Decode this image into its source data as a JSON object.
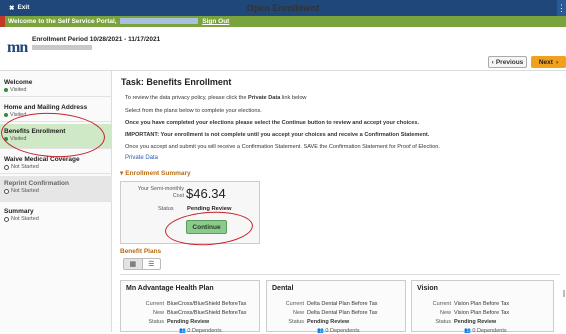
{
  "titlebar": {
    "exit_label": "Exit",
    "title": "Open Enrollment",
    "menu_glyph": "⋮"
  },
  "welcome_bar": {
    "text": "Welcome to the Self Service Portal,",
    "sign_out": "Sign Out"
  },
  "header": {
    "logo_text": "mn",
    "enrollment_period": "Enrollment Period  10/28/2021 - 11/17/2021",
    "prev_label": "Previous",
    "next_label": "Next"
  },
  "sidebar": {
    "items": [
      {
        "label": "Welcome",
        "status": "Visited"
      },
      {
        "label": "Home and Mailing Address",
        "status": "Visited"
      },
      {
        "label": "Benefits Enrollment",
        "status": "Visited"
      },
      {
        "label": "Waive Medical Coverage",
        "status": "Not Started"
      },
      {
        "label": "Reprint Confirmation",
        "status": "Not Started"
      },
      {
        "label": "Summary",
        "status": "Not Started"
      }
    ]
  },
  "main": {
    "title": "Task: Benefits Enrollment",
    "para1_a": "To review the data privacy policy, please click the ",
    "para1_b": "Private Data",
    "para1_c": " link below",
    "para2": "Select from the plans below to complete your elections.",
    "para3": "Once you have completed your elections please select the Continue button to review and accept your choices.",
    "para4": "IMPORTANT: Your enrollment is not complete until you accept your choices and receive a Confirmation Statement.",
    "para5": "Once you accept and submit you will receive a Confirmation Statement. SAVE the Confirmation Statement for Proof of Election.",
    "private_data_link": "Private Data",
    "summary_heading": "Enrollment Summary",
    "cost_label_1": "Your Semi-monthly",
    "cost_label_2": "Cost",
    "cost_value": "$46.34",
    "status_label": "Status",
    "status_value": "Pending Review",
    "continue_label": "Continue",
    "plans_heading": "Benefit Plans"
  },
  "plans": [
    {
      "name": "Mn Advantage Health Plan",
      "current_label": "Current",
      "current": "BlueCross/BlueShield BeforeTax",
      "new_label": "New",
      "new": "BlueCross/BlueShield BeforeTax",
      "status_label": "Status",
      "status": "Pending Review",
      "dependents": "0 Dependents"
    },
    {
      "name": "Dental",
      "current_label": "Current",
      "current": "Delta Dental Plan Before Tax",
      "new_label": "New",
      "new": "Delta Dental Plan Before Tax",
      "status_label": "Status",
      "status": "Pending Review",
      "dependents": "0 Dependents"
    },
    {
      "name": "Vision",
      "current_label": "Current",
      "current": "Vision Plan Before Tax",
      "new_label": "New",
      "new": "Vision Plan Before Tax",
      "status_label": "Status",
      "status": "Pending Review",
      "dependents": "0 Dependents"
    }
  ],
  "colors": {
    "titlebar": "#1f477a",
    "welcome_bar": "#79a33d",
    "next_button": "#f0a21e",
    "continue_button": "#8cc98c",
    "annotation": "#c8232b"
  }
}
